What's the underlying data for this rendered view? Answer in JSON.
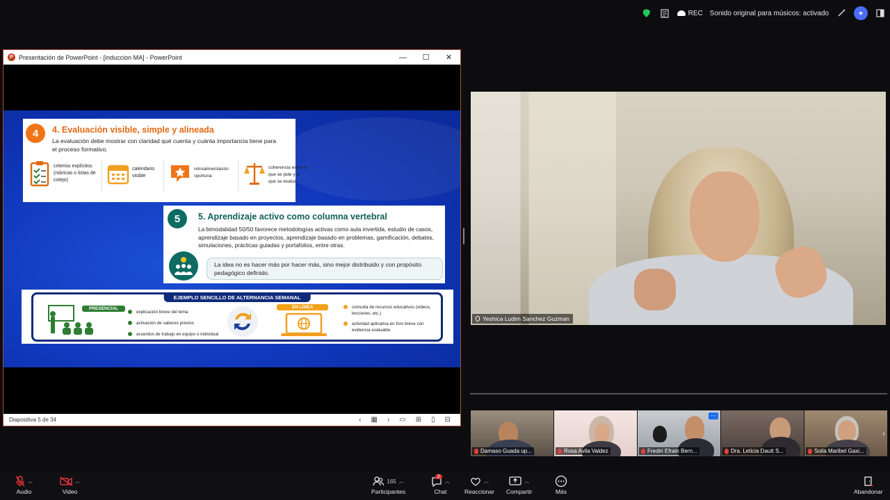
{
  "topbar": {
    "rec": "REC",
    "audio_status": "Sonido original para músicos: activado"
  },
  "ppt_window": {
    "title": "Presentación de PowerPoint - [induccion MA] - PowerPoint",
    "status": "Diapositiva 5 de 34"
  },
  "slide": {
    "s4": {
      "number": "4",
      "title": "4. Evaluación visible, simple y alineada",
      "desc": "La evaluación debe mostrar con claridad qué cuenta y cuánta importancia tiene para el proceso formativo.",
      "features": [
        "criterios explícitos (rúbricas o listas de cotejo)",
        "calendario visible",
        "retroalimentación oportuna",
        "coherencia entre lo que se pide y lo que se evalúa"
      ]
    },
    "s5": {
      "number": "5",
      "title": "5. Aprendizaje activo como columna vertebral",
      "desc": "La bimodalidad 50/50 favorece metodologías activas como aula invertida, estudio de casos, aprendizaje basado en proyectos, aprendizaje basado en problemas, gamificación, debates, simulaciones, prácticas guiadas y portafolios, entre otras.",
      "idea": "La idea no es hacer más por hacer más, sino mejor distribuido y con propósito pedagógico definido."
    },
    "week": {
      "title": "EJEMPLO SENCILLO DE ALTERNANCIA SEMANAL",
      "presencial_label": "PRESENCIAL",
      "presencial_items": [
        "explicación breve del tema",
        "activación de saberes previos",
        "acuerdos de trabajo en equipo o individual"
      ],
      "enlinea_label": "EN LÍNEA",
      "enlinea_items": [
        "consulta de recursos educativos (videos, lecciones, etc.)",
        "actividad aplicativa en foro breve con evidencia evaluable"
      ]
    }
  },
  "speaker": {
    "name": "Yeshica Ludim Sanchez Guzman"
  },
  "participants": [
    {
      "name": "Damaso Guada up..."
    },
    {
      "name": "Rosa Avila Valdez"
    },
    {
      "name": "Frediri Efrain Bern..."
    },
    {
      "name": "Dra. Leticia Dautt S..."
    },
    {
      "name": "Soila Maribel Gaxi..."
    }
  ],
  "toolbar": {
    "audio": "Audio",
    "video": "Video",
    "participants": "Participantes",
    "participants_count": "165",
    "chat": "Chat",
    "chat_badge": "2",
    "react": "Reaccionar",
    "share": "Compartir",
    "more": "Más",
    "leave": "Abandonar"
  },
  "colors": {
    "accent_orange": "#f07518",
    "accent_teal": "#0e6b63",
    "slide_blue": "#1b4fd6",
    "leave_red": "#e5323b"
  }
}
